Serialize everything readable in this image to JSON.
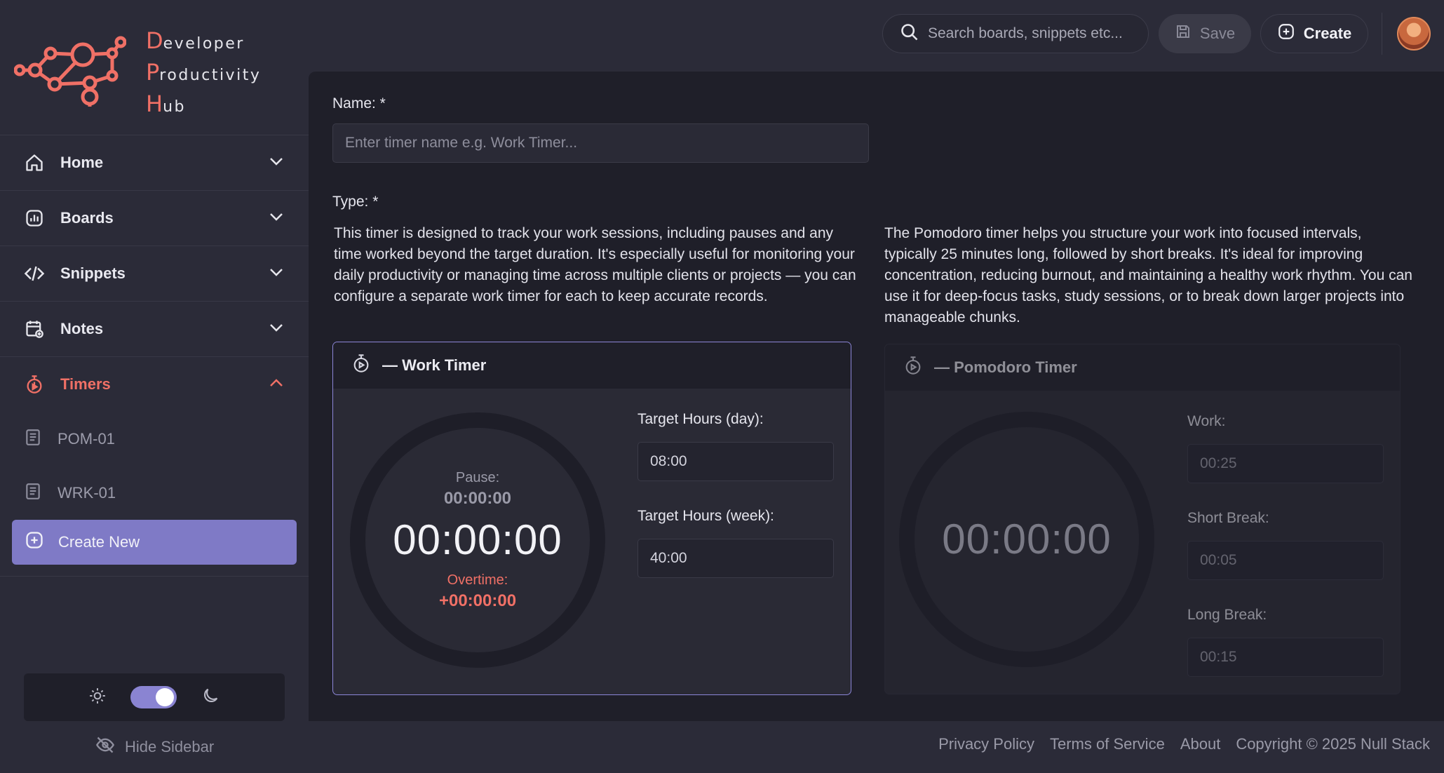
{
  "logo": {
    "lines": [
      {
        "cap": "D",
        "rest": "eveloper"
      },
      {
        "cap": "P",
        "rest": "roductivity"
      },
      {
        "cap": "H",
        "rest": "ub"
      }
    ]
  },
  "topbar": {
    "search_placeholder": "Search boards, snippets etc...",
    "save_label": "Save",
    "create_label": "Create"
  },
  "sidebar": {
    "items": [
      {
        "label": "Home",
        "icon": "home-icon"
      },
      {
        "label": "Boards",
        "icon": "chart-icon"
      },
      {
        "label": "Snippets",
        "icon": "code-icon"
      },
      {
        "label": "Notes",
        "icon": "calendar-note-icon"
      },
      {
        "label": "Timers",
        "icon": "stopwatch-icon",
        "active": true
      }
    ],
    "timers": [
      "POM-01",
      "WRK-01"
    ],
    "create_new_label": "Create New",
    "hide_sidebar_label": "Hide Sidebar"
  },
  "form": {
    "name_label": "Name: *",
    "name_placeholder": "Enter timer name e.g. Work Timer...",
    "type_label": "Type: *",
    "work_desc": "This timer is designed to track your work sessions, including pauses and any time worked beyond the target duration. It's especially useful for monitoring your daily productivity or managing time across multiple clients or projects — you can configure a separate work timer for each to keep accurate records.",
    "pomo_desc": "The Pomodoro timer helps you structure your work into focused intervals, typically 25 minutes long, followed by short breaks. It's ideal for improving concentration, reducing burnout, and maintaining a healthy work rhythm. You can use it for deep-focus tasks, study sessions, or to break down larger projects into manageable chunks."
  },
  "work_card": {
    "title": "— Work Timer",
    "pause_label": "Pause:",
    "pause_time": "00:00:00",
    "time": "00:00:00",
    "overtime_label": "Overtime:",
    "overtime_time": "+00:00:00",
    "target_day_label": "Target Hours (day):",
    "target_day_value": "08:00",
    "target_week_label": "Target Hours (week):",
    "target_week_value": "40:00"
  },
  "pomo_card": {
    "title": "— Pomodoro Timer",
    "time": "00:00:00",
    "work_label": "Work:",
    "work_value": "00:25",
    "short_label": "Short Break:",
    "short_value": "00:05",
    "long_label": "Long Break:",
    "long_value": "00:15"
  },
  "footer": {
    "privacy": "Privacy Policy",
    "terms": "Terms of Service",
    "about": "About",
    "copyright": "Copyright © 2025 Null Stack"
  },
  "colors": {
    "accent": "#f07066",
    "primary": "#7f7ac6",
    "background": "#2b2b38",
    "panel": "#1f1f29"
  }
}
